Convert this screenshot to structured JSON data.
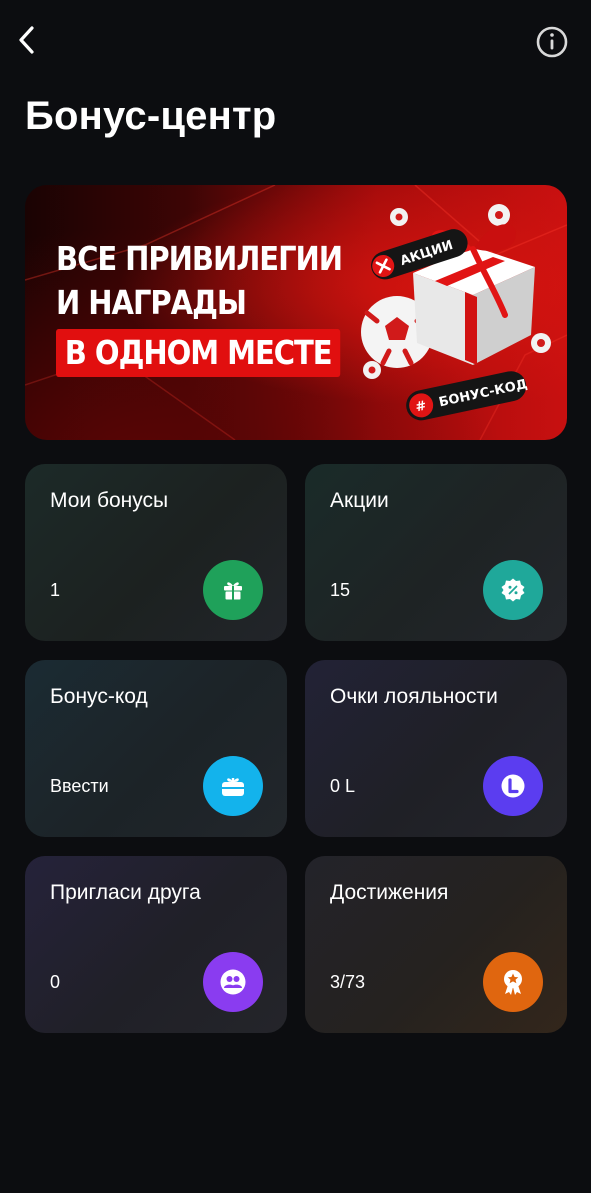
{
  "header": {
    "back_icon": "chevron-left-icon",
    "info_icon": "info-circle-icon",
    "title": "Бонус-центр"
  },
  "banner": {
    "line1": "ВСЕ ПРИВИЛЕГИИ",
    "line2": "И НАГРАДЫ",
    "highlight": "В ОДНОМ МЕСТЕ",
    "tag_promos": "АКЦИИ",
    "tag_code": "БОНУС-КОД",
    "tag_code_symbol": "#",
    "colors": {
      "background": "#b30d0d",
      "highlight": "#e10f0f"
    }
  },
  "tiles": [
    {
      "title": "Мои бонусы",
      "value": "1",
      "icon": "gift-icon",
      "icon_color": "#1fa15a"
    },
    {
      "title": "Акции",
      "value": "15",
      "icon": "percent-badge-icon",
      "icon_color": "#1fa89a"
    },
    {
      "title": "Бонус-код",
      "value": "Ввести",
      "icon": "gift-card-icon",
      "icon_color": "#13b3ec"
    },
    {
      "title": "Очки лояльности",
      "value": "0 L",
      "icon": "loyalty-l-icon",
      "icon_color": "#5b3df0"
    },
    {
      "title": "Пригласи друга",
      "value": "0",
      "icon": "people-icon",
      "icon_color": "#8a3cf0"
    },
    {
      "title": "Достижения",
      "value": "3/73",
      "icon": "medal-icon",
      "icon_color": "#e0660f"
    }
  ]
}
